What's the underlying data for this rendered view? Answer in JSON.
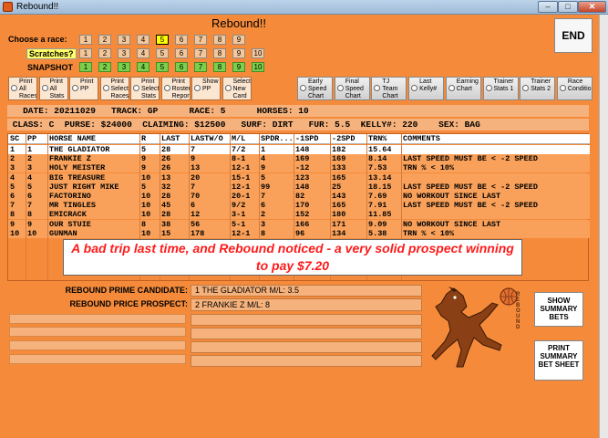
{
  "window": {
    "title": "Rebound!!",
    "min": "–",
    "max": "□",
    "close": "✕"
  },
  "page_title": "Rebound!!",
  "race_row": {
    "label": "Choose  a race:",
    "numbers": [
      "1",
      "2",
      "3",
      "4",
      "5",
      "6",
      "7",
      "8",
      "9"
    ],
    "selected": "5"
  },
  "scratch_row": {
    "label": "Scratches?",
    "numbers": [
      "1",
      "2",
      "3",
      "4",
      "5",
      "6",
      "7",
      "8",
      "9",
      "10"
    ]
  },
  "snapshot_row": {
    "label": "SNAPSHOT",
    "numbers": [
      "1",
      "2",
      "3",
      "4",
      "5",
      "6",
      "7",
      "8",
      "9",
      "10"
    ]
  },
  "end_label": "END",
  "options": [
    {
      "label": "Print All Races"
    },
    {
      "label": "Print All Stats"
    },
    {
      "label": "Print PP"
    },
    {
      "label": "Print Selected Races"
    },
    {
      "label": "Print Selected Stats"
    },
    {
      "label": "Print Roster Report"
    },
    {
      "label": "Show PP"
    },
    {
      "label": "Select New Card"
    }
  ],
  "charts": [
    {
      "label": "Early Speed Chart"
    },
    {
      "label": "Final Speed Chart"
    },
    {
      "label": "TJ Team Chart"
    },
    {
      "label": "Last Kelly#"
    },
    {
      "label": "Earning Chart"
    },
    {
      "label": "Trainer Stats 1"
    },
    {
      "label": "Trainer Stats 2"
    },
    {
      "label": "Race Conditions"
    }
  ],
  "race_info": {
    "line1": "   DATE: 20211029   TRACK: GP      RACE: 5      HORSES: 10",
    "line2": " CLASS: C  PURSE: $24000  CLAIMING: $12500   SURF: DIRT   FUR: 5.5  KELLY#: 220    SEX: BAG"
  },
  "table": {
    "headers": [
      "SC",
      "PP",
      "HORSE NAME",
      "R",
      "LAST",
      "LASTW/O",
      "M/L",
      "SPDR...",
      "-1SPD",
      "-2SPD",
      "TRN%",
      "COMMENTS"
    ],
    "rows": [
      [
        "1",
        "1",
        "THE GLADIATOR",
        "5",
        "28",
        "7",
        "7/2",
        "1",
        "148",
        "182",
        "15.64",
        ""
      ],
      [
        "2",
        "2",
        "FRANKIE Z",
        "9",
        "26",
        "9",
        "8-1",
        "4",
        "169",
        "169",
        "8.14",
        "LAST SPEED MUST BE < -2 SPEED"
      ],
      [
        "3",
        "3",
        "HOLY MEISTER",
        "9",
        "26",
        "13",
        "12-1",
        "9",
        "-12",
        "133",
        "7.53",
        "TRN % < 10%"
      ],
      [
        "4",
        "4",
        "BIG TREASURE",
        "10",
        "13",
        "20",
        "15-1",
        "5",
        "123",
        "165",
        "13.14",
        ""
      ],
      [
        "5",
        "5",
        "JUST RIGHT MIKE",
        "5",
        "32",
        "7",
        "12-1",
        "99",
        "148",
        "25",
        "18.15",
        "LAST SPEED MUST BE < -2 SPEED"
      ],
      [
        "6",
        "6",
        "FACTORINO",
        "10",
        "28",
        "70",
        "20-1",
        "7",
        "82",
        "143",
        "7.69",
        "NO WORKOUT SINCE LAST"
      ],
      [
        "7",
        "7",
        "MR TINGLES",
        "10",
        "45",
        "6",
        "9/2",
        "6",
        "170",
        "165",
        "7.91",
        "LAST SPEED MUST BE < -2 SPEED"
      ],
      [
        "8",
        "8",
        "EMICRACK",
        "10",
        "28",
        "12",
        "3-1",
        "2",
        "152",
        "180",
        "11.85",
        ""
      ],
      [
        "9",
        "9",
        "OUR STUIE",
        "8",
        "38",
        "56",
        "5-1",
        "3",
        "166",
        "171",
        "9.09",
        "NO WORKOUT SINCE LAST"
      ],
      [
        "10",
        "10",
        "GUNMAN",
        "10",
        "15",
        "178",
        "12-1",
        "8",
        "96",
        "134",
        "5.38",
        "TRN % < 10%"
      ]
    ]
  },
  "comment": "A bad trip last time, and Rebound noticed - a very solid prospect winning to pay $7.20",
  "prime": {
    "label": "REBOUND PRIME CANDIDATE:",
    "value": "1  THE GLADIATOR   M/L: 3.5"
  },
  "price": {
    "label": "REBOUND PRICE PROSPECT:",
    "value": "2  FRANKIE Z       M/L: 8"
  },
  "show_summary": "SHOW SUMMARY BETS",
  "print_summary": "PRINT SUMMARY BET SHEET",
  "logo_text": "REBOUND",
  "colors": {
    "background": "#f58b3a",
    "selected_race": "#ffff00",
    "snapshot": "#7bd04b",
    "comment": "#ff1a1a"
  }
}
